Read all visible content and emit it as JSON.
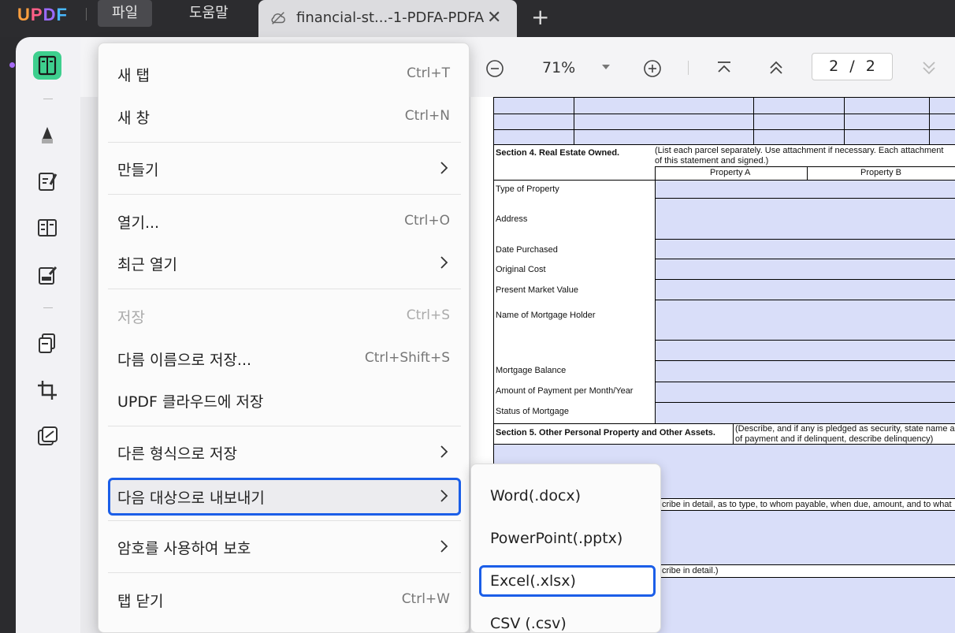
{
  "app": {
    "logo": "UPDF",
    "menu": {
      "file": "파일",
      "help": "도움말"
    },
    "tab": {
      "title": "financial-st...-1-PDFA-PDFA",
      "close": "✕",
      "new_tab": "+"
    }
  },
  "toolbar": {
    "zoom": "71%",
    "page_current": "2",
    "page_sep": "/",
    "page_total": "2"
  },
  "file_menu": {
    "items": [
      {
        "label": "새 탭",
        "shortcut": "Ctrl+T"
      },
      {
        "label": "새 창",
        "shortcut": "Ctrl+N"
      },
      {
        "label": "만들기"
      },
      {
        "label": "열기...",
        "shortcut": "Ctrl+O"
      },
      {
        "label": "최근 열기"
      },
      {
        "label": "저장",
        "shortcut": "Ctrl+S",
        "disabled": true
      },
      {
        "label": "다름 이름으로 저장...",
        "shortcut": "Ctrl+Shift+S"
      },
      {
        "label": "UPDF 클라우드에 저장"
      },
      {
        "label": "다른 형식으로 저장"
      },
      {
        "label": "다음 대상으로 내보내기",
        "highlighted": true
      },
      {
        "label": "암호를 사용하여 보호"
      },
      {
        "label": "탭 닫기",
        "shortcut": "Ctrl+W"
      }
    ]
  },
  "export_submenu": {
    "items": [
      {
        "label": "Word(.docx)"
      },
      {
        "label": "PowerPoint(.pptx)"
      },
      {
        "label": "Excel(.xlsx)",
        "highlighted": true
      },
      {
        "label": "CSV (.csv)"
      }
    ]
  },
  "pdf": {
    "section4_title": "Section 4. Real Estate Owned.",
    "section4_note_1": "(List each parcel separately.  Use attachment if necessary.  Each attachment",
    "section4_note_2": "of this statement and signed.)",
    "property_a": "Property A",
    "property_b": "Property B",
    "rows": [
      "Type of Property",
      "Address",
      "Date Purchased",
      "Original Cost",
      "Present Market Value",
      "Name of Mortgage Holder",
      "Mortgage Balance",
      "Amount of Payment per Month/Year",
      "Status of Mortgage"
    ],
    "section5_title": "Section 5. Other Personal Property and Other Assets.",
    "section5_note_1": "(Describe, and if any is pledged as security, state name and ad",
    "section5_note_2": "of payment and if delinquent, describe delinquency)",
    "section6_fragment": "cribe in detail, as to type, to whom payable, when due, amount, and to what",
    "section7_fragment": "cribe in detail.)"
  },
  "colors": {
    "accent": "#1b5ee8",
    "form_fill": "#d9def9",
    "logo_u": "#ff9f3f",
    "logo_p": "#ff5f87",
    "logo_d": "#9b6bff",
    "logo_f": "#49b8ff"
  }
}
